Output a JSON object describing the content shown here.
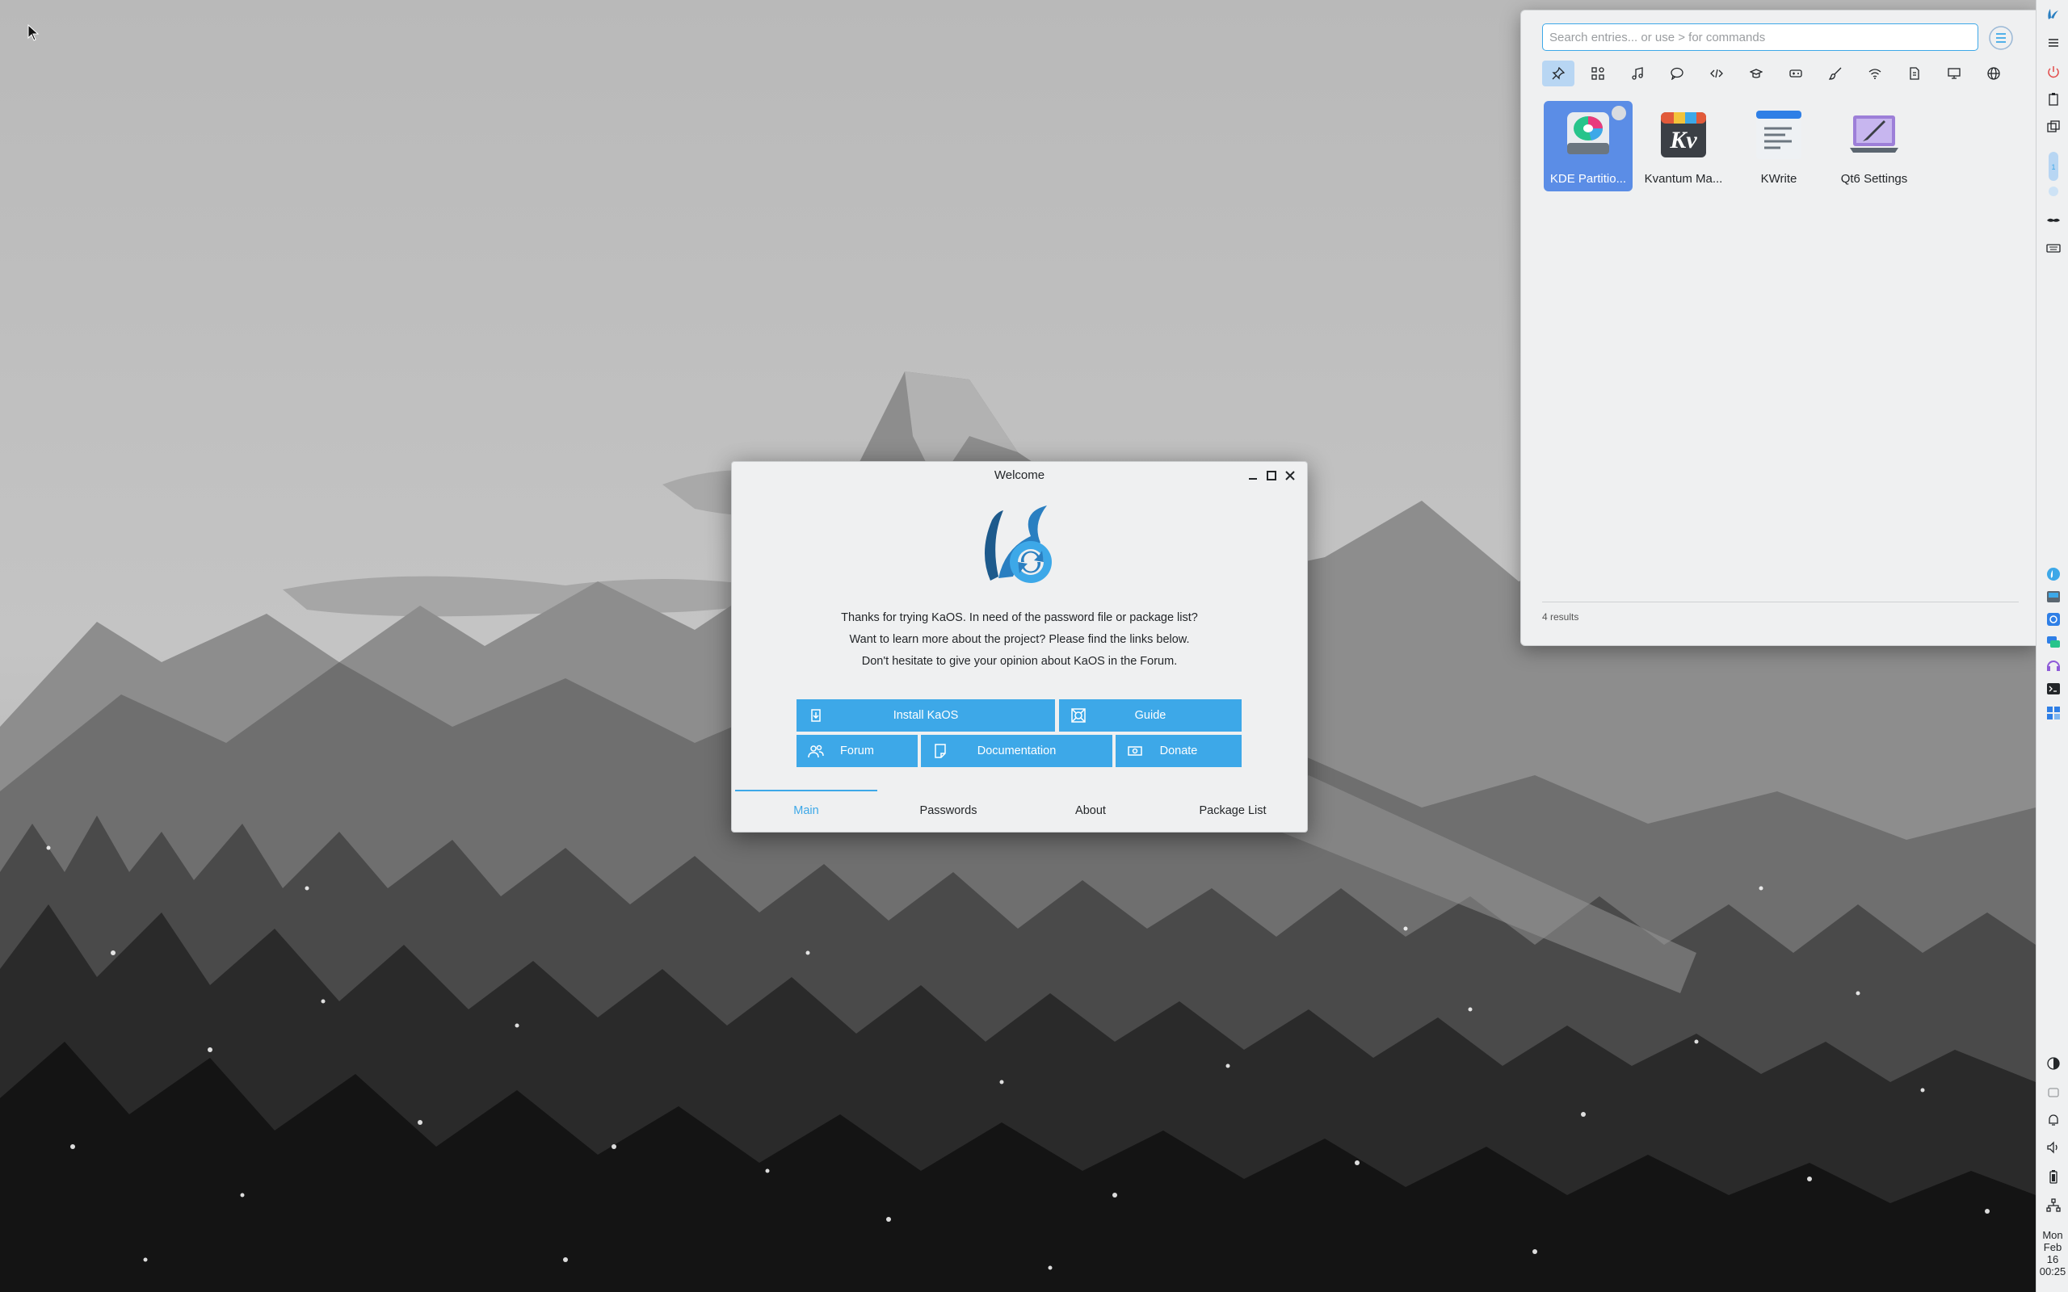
{
  "welcome": {
    "title": "Welcome",
    "lines": [
      "Thanks for trying KaOS. In need of the password file or package list?",
      "Want to learn more about the project? Please find the links below.",
      "Don't hesitate to give your opinion about KaOS in the Forum."
    ],
    "buttons": {
      "install": "Install KaOS",
      "guide": "Guide",
      "forum": "Forum",
      "documentation": "Documentation",
      "donate": "Donate"
    },
    "tabs": [
      "Main",
      "Passwords",
      "About",
      "Package List"
    ],
    "active_tab": "Main"
  },
  "launcher": {
    "search_placeholder": "Search entries... or use > for commands",
    "categories": [
      "pinned-icon",
      "apps-icon",
      "music-icon",
      "chat-icon",
      "code-icon",
      "education-icon",
      "games-icon",
      "graphics-icon",
      "wifi-icon",
      "office-icon",
      "system-icon",
      "internet-icon"
    ],
    "apps": [
      {
        "label": "KDE Partitio...",
        "active": true
      },
      {
        "label": "Kvantum Ma...",
        "active": false
      },
      {
        "label": "KWrite",
        "active": false
      },
      {
        "label": "Qt6 Settings",
        "active": false
      }
    ],
    "results": "4 results"
  },
  "panel": {
    "clock": [
      "Mon",
      "Feb",
      "16",
      "00:25"
    ]
  },
  "colors": {
    "accent": "#3da8e8",
    "selection": "#5b8de6",
    "panel_bg": "#eff0f1"
  }
}
